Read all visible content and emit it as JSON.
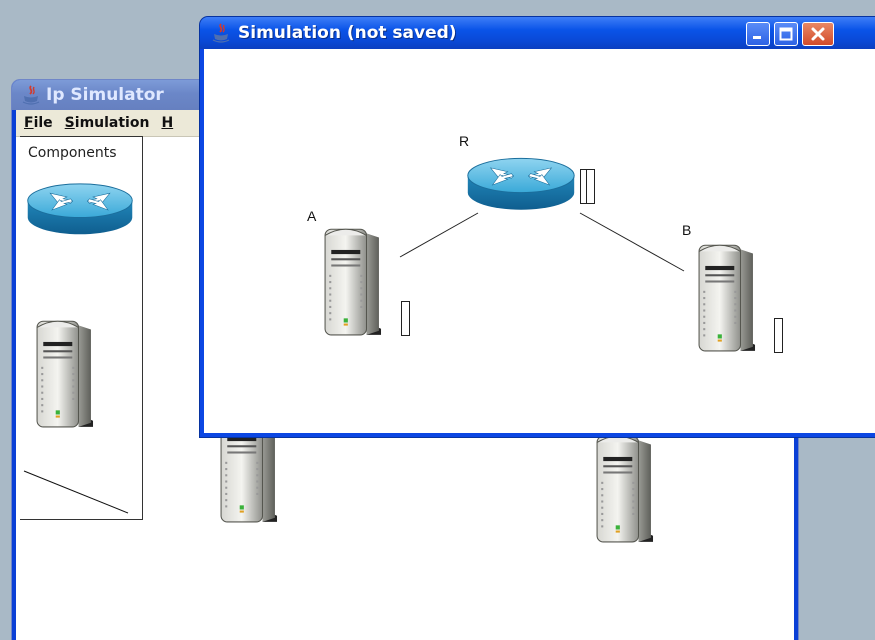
{
  "back_window": {
    "title": "Ip Simulator",
    "menu": [
      {
        "key": "F",
        "rest": "ile"
      },
      {
        "key": "S",
        "rest": "imulation"
      },
      {
        "key": "H",
        "rest": ""
      }
    ],
    "palette_label": "Components",
    "palette_items": [
      "router-icon",
      "server-icon",
      "link-line-icon"
    ]
  },
  "front_window": {
    "title": "Simulation (not saved)",
    "buttons": [
      "minimize-icon",
      "maximize-icon",
      "close-icon"
    ],
    "nodes": {
      "router": {
        "label": "R",
        "type": "router"
      },
      "host_a": {
        "label": "A",
        "type": "server"
      },
      "host_b": {
        "label": "B",
        "type": "server"
      }
    }
  },
  "colors": {
    "active_title": "#0a54e8",
    "inactive_title": "#7d9bd8",
    "router_blue": "#2fa0d2",
    "close_red": "#d24b2a"
  }
}
